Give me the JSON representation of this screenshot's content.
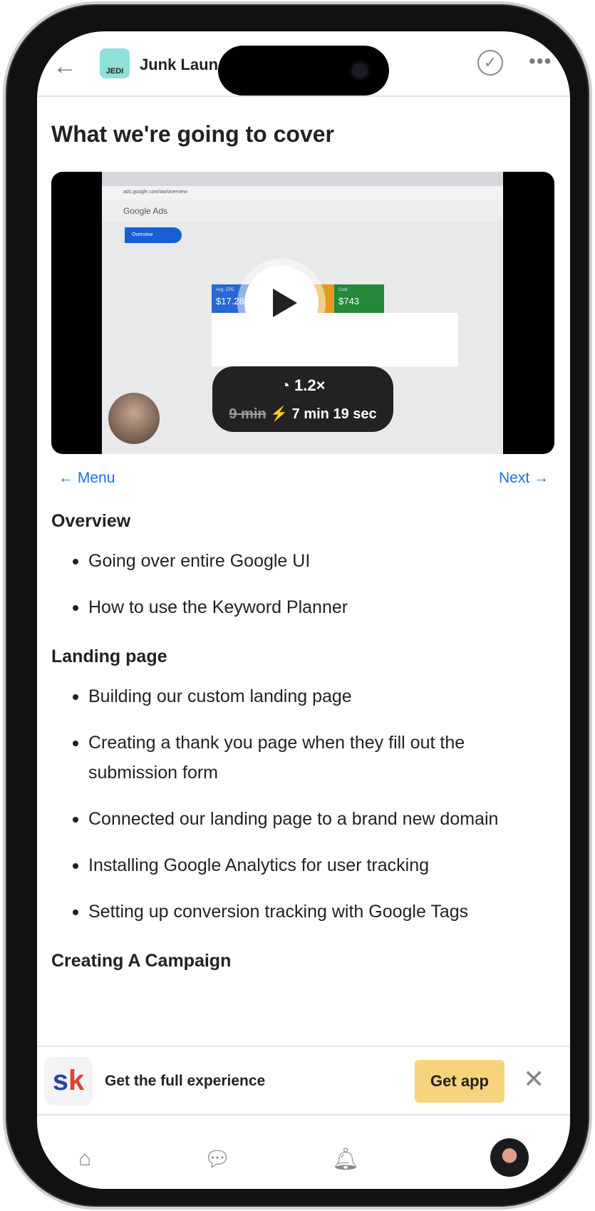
{
  "header": {
    "title": "Junk Laun",
    "back_icon": "arrow-left-icon",
    "complete_icon": "check-circle-icon",
    "more_icon": "ellipsis-icon",
    "logo_text": "JEDI"
  },
  "lesson": {
    "title": "What we're going to cover"
  },
  "video": {
    "screen": {
      "url": "ads.google.com/aw/overview",
      "app": "Google Ads",
      "nav_selected": "Overview",
      "tile1_label": "Avg. CPC",
      "tile1_value": "$17.28",
      "tile3_label": "Cost",
      "tile3_value": "$743"
    },
    "speed": "1.2×",
    "original_duration": "9 min",
    "fast_duration": "7 min 19 sec",
    "play_icon": "play-icon"
  },
  "nav": {
    "prev": "Menu",
    "next": "Next"
  },
  "sections": [
    {
      "heading": "Overview",
      "items": [
        "Going over entire Google UI",
        "How to use the Keyword Planner"
      ]
    },
    {
      "heading": "Landing page",
      "items": [
        "Building our custom landing page",
        "Creating a thank you page when they fill out the submission form",
        "Connected our landing page to a brand new domain",
        "Installing Google Analytics for user tracking",
        "Setting up conversion tracking with Google Tags"
      ]
    },
    {
      "heading": "Creating A Campaign",
      "items": []
    }
  ],
  "banner": {
    "logo": "sk",
    "text": "Get the full experience",
    "button": "Get app"
  },
  "tabbar": [
    "home-icon",
    "chat-icon",
    "bell-icon",
    "profile-avatar"
  ],
  "colors": {
    "link": "#1a6fe0",
    "get_app": "#f8d37e"
  }
}
